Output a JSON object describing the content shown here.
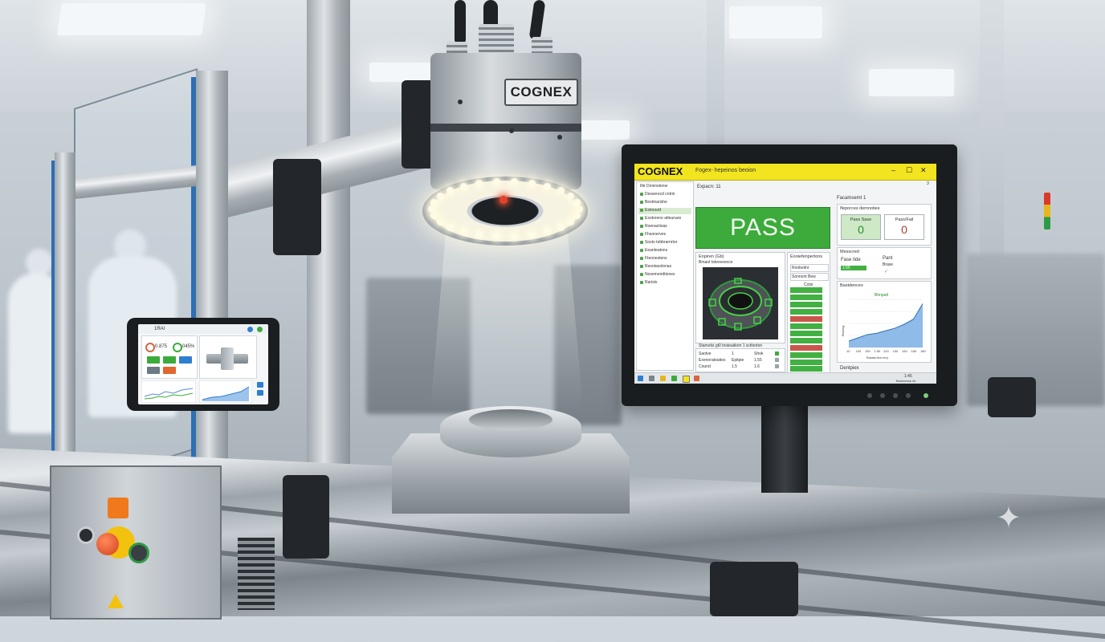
{
  "camera": {
    "brand": "COGNEX"
  },
  "monitor": {
    "brand": "COGNEX",
    "window_title": "Fogex- hepeinos beoion",
    "window_number": "3",
    "controls": {
      "minimize": "–",
      "maximize": "☐",
      "close": "✕"
    },
    "sidebar_title": "Iltir Dnninstenw",
    "sidebar_items": [
      {
        "label": "Desserecd cntrin",
        "selected": false
      },
      {
        "label": "Bestmarishe",
        "selected": false
      },
      {
        "label": "Extoourd",
        "selected": true
      },
      {
        "label": "Exotoreno atteunare",
        "selected": false
      },
      {
        "label": "Roenactioas",
        "selected": false
      },
      {
        "label": "Fhsonerves",
        "selected": false
      },
      {
        "label": "Sosto tebbrarnrtor",
        "selected": false
      },
      {
        "label": "Eeanteatons",
        "selected": false
      },
      {
        "label": "Fteonestens",
        "selected": false
      },
      {
        "label": "Resotasotsnas",
        "selected": false
      },
      {
        "label": "Nosemendtiones",
        "selected": false
      },
      {
        "label": "Rarists",
        "selected": false
      }
    ],
    "center_header": "Expacn: 11",
    "result": "PASS",
    "image_panel": {
      "title": "Enpiren (Gb)",
      "subtitle": "Bmaot tsteovoecce"
    },
    "results_title": "Stamotis gt0 tnsteaitiom 1 scttiorton",
    "result_rows": [
      {
        "c1": "Saotve",
        "c2": "1",
        "c3": "Shok"
      },
      {
        "c1": "Exenorateaties",
        "c2": "Epitpie",
        "c3": "1.55"
      },
      {
        "c1": "Cound",
        "c2": "1.5",
        "c3": "1.6"
      }
    ],
    "side_panel_title": "Eooiefenpertons",
    "side_panel_items": [
      "Ronbeilnr",
      "Sonnont Bew"
    ],
    "side_panel_list_header": "Cotsi",
    "second_tab": "Facamsemt 1",
    "counter_section": "Ifeporces demnoties",
    "pass_count": {
      "label": "Pass Sase",
      "value": "0"
    },
    "fail_count": {
      "label": "Pass/Fail",
      "value": "0"
    },
    "measured_title": "Messcred",
    "pass_rate": {
      "label": "Fase tide",
      "value": "1:55"
    },
    "paint": {
      "label": "Pant",
      "value": "Brase"
    },
    "chart_title": "Bastdences",
    "chart_series_label": "Bhnpatl",
    "chart_x_ticks": [
      "10",
      "100",
      "150",
      "1:50",
      "120",
      "150",
      "150",
      "180",
      "180"
    ],
    "footer": "Dentpiex",
    "taskbar_time": "1:45",
    "taskbar_date": "Busnuresu 6z"
  },
  "chart_data": {
    "type": "area",
    "title": "Bhnpatl",
    "xlabel": "Bastarriion tes)",
    "ylabel": "Btowng",
    "x": [
      "10",
      "100",
      "150",
      "1:50",
      "120",
      "150",
      "150",
      "180",
      "180"
    ],
    "series": [
      {
        "name": "",
        "values": [
          1,
          1.5,
          2,
          2.2,
          2.6,
          3,
          3.6,
          4.4,
          6.8
        ]
      }
    ]
  },
  "tablet": {
    "title": "1RAI",
    "value1": "0.875",
    "value2": "045%"
  },
  "colors": {
    "pass_green": "#3cab3c",
    "cognex_yellow": "#f2e51f",
    "fail_red": "#c9574b"
  }
}
